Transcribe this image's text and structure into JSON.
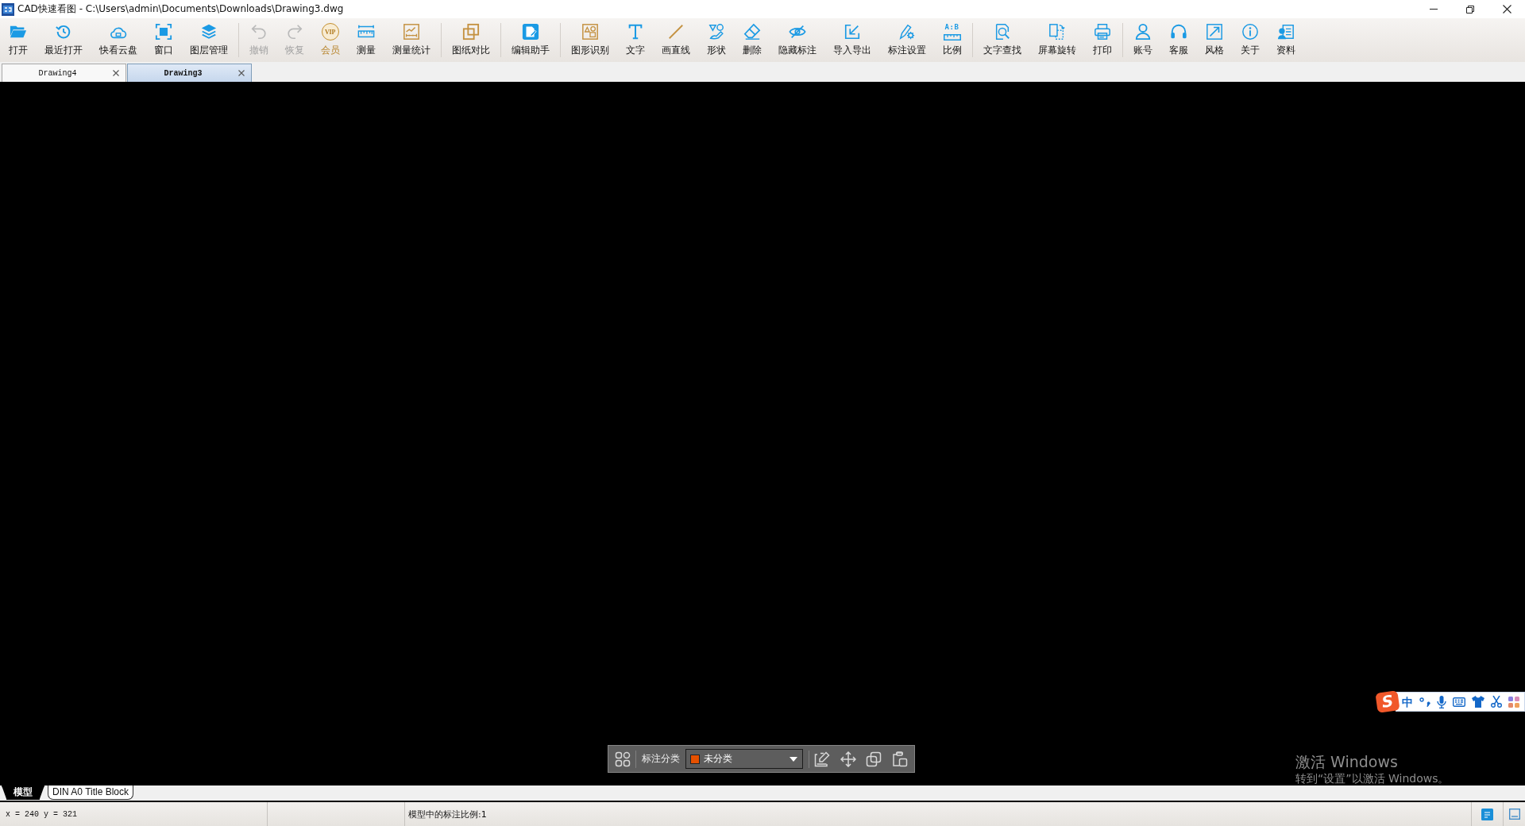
{
  "window": {
    "title": "CAD快速看图 - C:\\Users\\admin\\Documents\\Downloads\\Drawing3.dwg"
  },
  "toolbar": {
    "groups": [
      [
        {
          "label": "打开",
          "disabled": false
        },
        {
          "label": "最近打开",
          "disabled": false
        },
        {
          "label": "快看云盘",
          "disabled": false
        },
        {
          "label": "窗口",
          "disabled": false
        },
        {
          "label": "图层管理",
          "disabled": false
        }
      ],
      [
        {
          "label": "撤销",
          "disabled": true
        },
        {
          "label": "恢复",
          "disabled": true
        },
        {
          "label": "会员",
          "disabled": false,
          "badge": "VIP"
        },
        {
          "label": "测量",
          "disabled": false
        },
        {
          "label": "测量统计",
          "disabled": false
        }
      ],
      [
        {
          "label": "图纸对比",
          "disabled": false
        }
      ],
      [
        {
          "label": "编辑助手",
          "disabled": false
        }
      ],
      [
        {
          "label": "图形识别",
          "disabled": false
        },
        {
          "label": "文字",
          "disabled": false
        },
        {
          "label": "画直线",
          "disabled": false
        },
        {
          "label": "形状",
          "disabled": false
        },
        {
          "label": "删除",
          "disabled": false
        },
        {
          "label": "隐藏标注",
          "disabled": false
        },
        {
          "label": "导入导出",
          "disabled": false
        },
        {
          "label": "标注设置",
          "disabled": false
        },
        {
          "label": "比例",
          "disabled": false,
          "badge": "A:B"
        }
      ],
      [
        {
          "label": "文字查找",
          "disabled": false
        },
        {
          "label": "屏幕旋转",
          "disabled": false
        },
        {
          "label": "打印",
          "disabled": false
        }
      ],
      [
        {
          "label": "账号",
          "disabled": false
        },
        {
          "label": "客服",
          "disabled": false
        },
        {
          "label": "风格",
          "disabled": false
        },
        {
          "label": "关于",
          "disabled": false
        },
        {
          "label": "资料",
          "disabled": false
        }
      ]
    ]
  },
  "document_tabs": [
    {
      "label": "Drawing4",
      "selected": false
    },
    {
      "label": "Drawing3",
      "selected": true
    }
  ],
  "annotation_toolbar": {
    "label": "标注分类",
    "category": {
      "value": "未分类",
      "color": "#e65100"
    }
  },
  "ime_bar": {
    "logo": "S",
    "mode": "中"
  },
  "activation_notice": {
    "title": "激活 Windows",
    "message": "转到“设置”以激活 Windows。"
  },
  "layout_tabs": [
    {
      "label": "模型",
      "selected": true
    },
    {
      "label": "DIN A0 Title Block",
      "selected": false
    }
  ],
  "status_bar": {
    "coordinates": "x = 240 y = 321",
    "annotation_scale": "模型中的标注比例:1"
  }
}
